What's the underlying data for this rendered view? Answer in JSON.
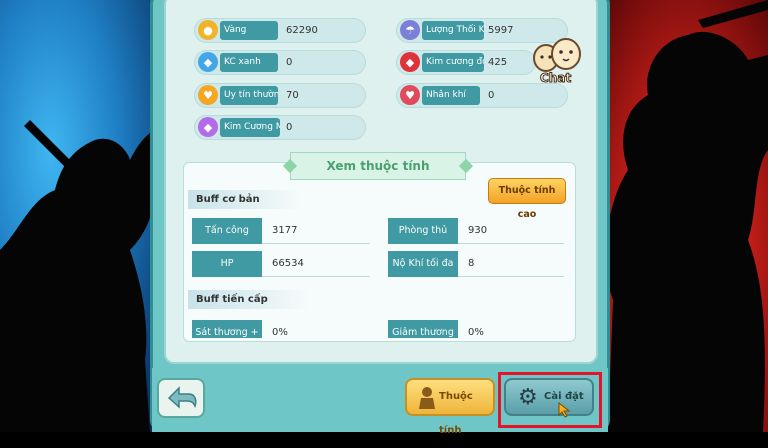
{
  "currencies": [
    {
      "icon": "gold-coin-icon",
      "label": "Vàng",
      "value": "62290",
      "color": "#f0b428"
    },
    {
      "icon": "green-diamond-icon",
      "label": "KC xanh",
      "value": "0",
      "color": "#42a6e8"
    },
    {
      "icon": "prestige-icon",
      "label": "Uy tín thường",
      "value": "70",
      "color": "#f5a623"
    },
    {
      "icon": "color-diamond-icon",
      "label": "Kim Cương Màu",
      "value": "0",
      "color": "#b36be8"
    },
    {
      "icon": "thoi-khan-icon",
      "label": "Lượng Thối Khân",
      "value": "5997",
      "color": "#7b7fd8"
    },
    {
      "icon": "red-diamond-icon",
      "label": "Kim cương đỏ",
      "value": "425",
      "color": "#e0323a"
    },
    {
      "icon": "heart-icon",
      "label": "Nhân khí",
      "value": "0",
      "color": "#e04a5a"
    }
  ],
  "attributes": {
    "title": "Xem thuộc tính",
    "advanced_button": "Thuộc tính cao",
    "basic_title": "Buff cơ bản",
    "basic_stats": [
      {
        "label": "Tấn công",
        "value": "3177"
      },
      {
        "label": "Phòng thủ",
        "value": "930"
      },
      {
        "label": "HP",
        "value": "66534"
      },
      {
        "label": "Nộ Khí tối đa",
        "value": "8"
      }
    ],
    "advanced_title": "Buff tiến cấp",
    "advanced_stats": [
      {
        "label": "Sát thương +",
        "value": "0%"
      },
      {
        "label": "Giảm thương",
        "value": "0%"
      }
    ]
  },
  "chat_label": "Chat",
  "bottom": {
    "attr_button": "Thuộc tính",
    "settings_button": "Cài đặt"
  }
}
